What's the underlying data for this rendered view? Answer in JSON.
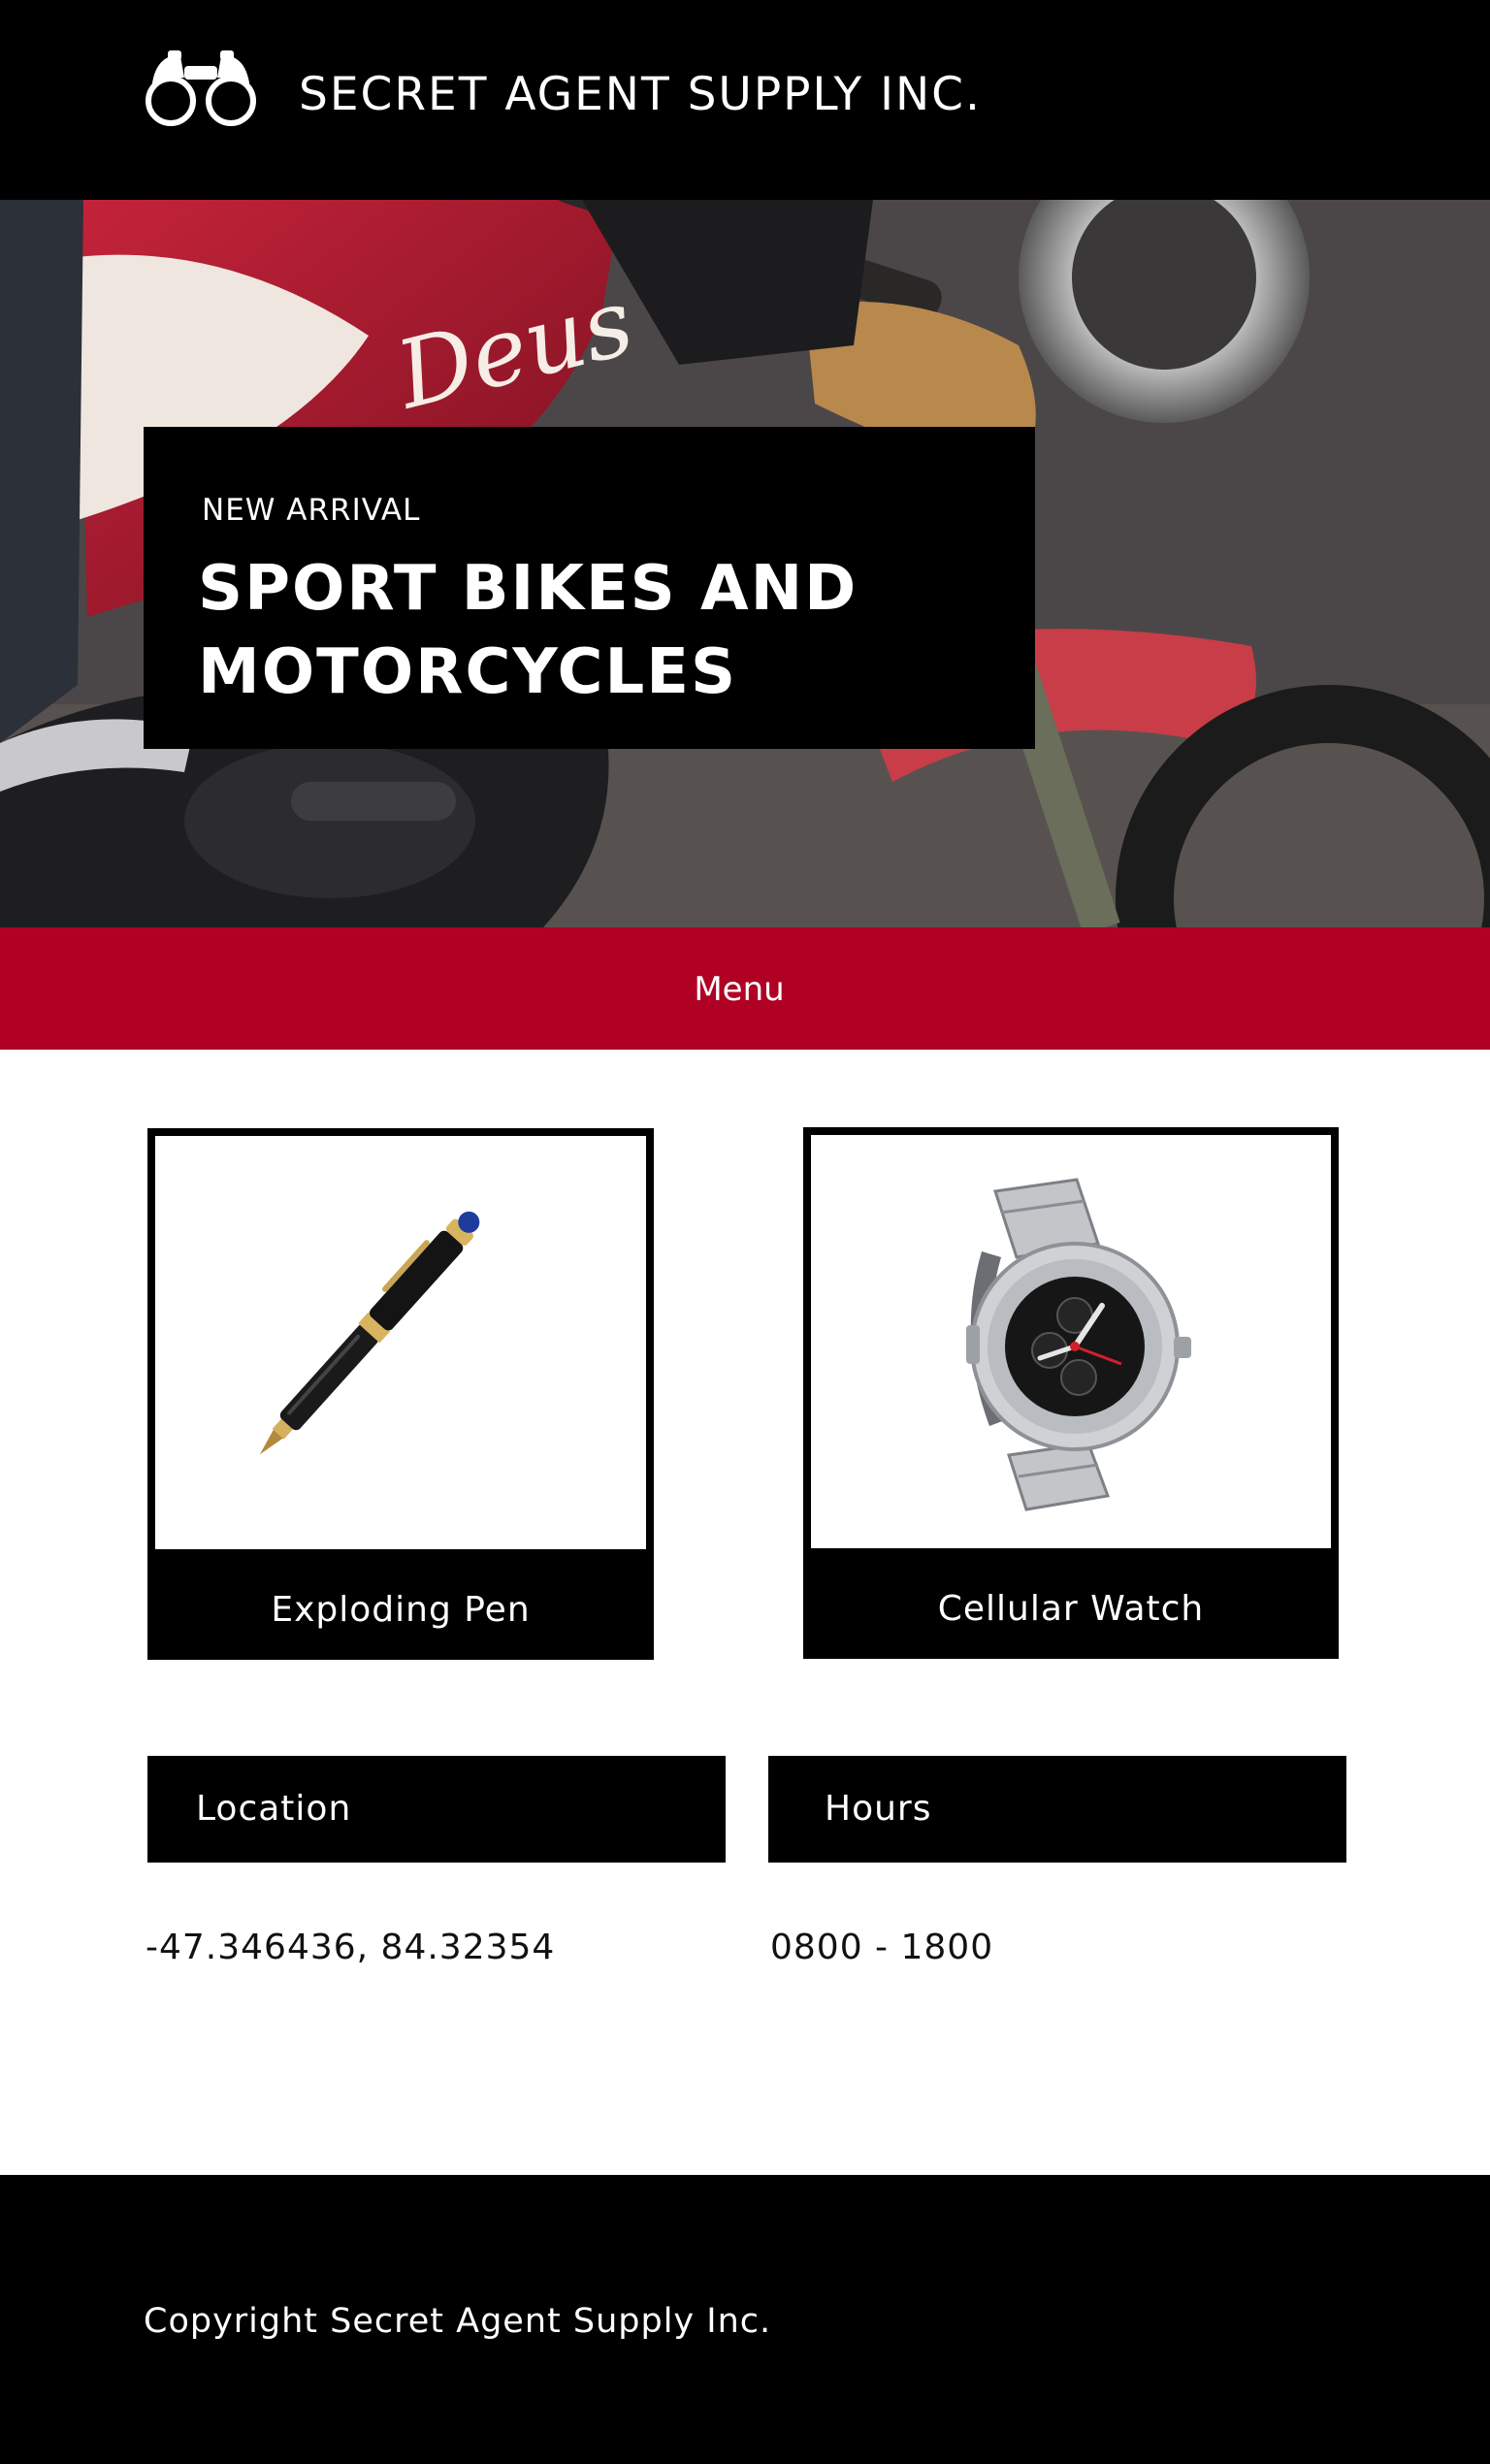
{
  "header": {
    "logo_icon": "binoculars-icon",
    "site_title": "SECRET AGENT SUPPLY INC."
  },
  "hero": {
    "background": "motorcycle-photo",
    "kicker": "NEW ARRIVAL",
    "title": "SPORT BIKES AND MOTORCYCLES"
  },
  "menu": {
    "label": "Menu",
    "color": "#b00024"
  },
  "products": [
    {
      "name": "Exploding Pen",
      "image": "pen-image"
    },
    {
      "name": "Cellular Watch",
      "image": "watch-image"
    }
  ],
  "info": {
    "location": {
      "label": "Location",
      "value": "-47.346436, 84.32354"
    },
    "hours": {
      "label": "Hours",
      "value": "0800 - 1800"
    }
  },
  "footer": {
    "copyright": "Copyright Secret Agent Supply Inc."
  }
}
